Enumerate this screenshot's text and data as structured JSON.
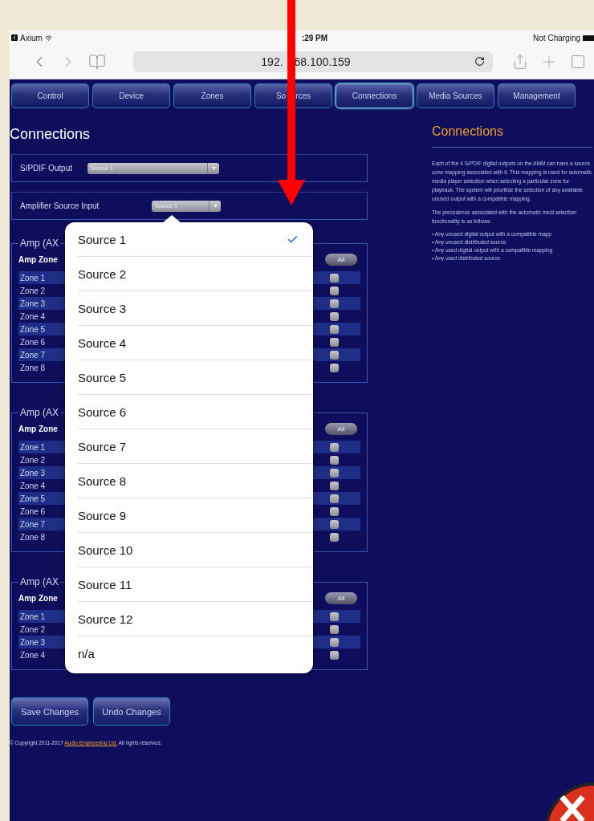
{
  "status_bar": {
    "back_app": "Axium",
    "time": ":29 PM",
    "battery": "Not Charging"
  },
  "browser": {
    "url_parts": [
      "192.",
      "68.100.159"
    ]
  },
  "tabs": [
    {
      "label": "Control",
      "selected": false
    },
    {
      "label": "Device",
      "selected": false
    },
    {
      "label": "Zones",
      "selected": false
    },
    {
      "label": [
        "So",
        "rces"
      ],
      "selected": false
    },
    {
      "label": "Connections",
      "selected": true
    },
    {
      "label": "Media Sources",
      "selected": false
    },
    {
      "label": "Management",
      "selected": false
    }
  ],
  "page": {
    "title": "Connections"
  },
  "selects": [
    {
      "label": "S/PDIF Output",
      "value": "Source 1"
    },
    {
      "label": "Amplifier Source Input",
      "value": "Source 1"
    }
  ],
  "amps": [
    {
      "title": "Amp (AX",
      "header": "Amp Zone",
      "all_button": "All",
      "zones": [
        {
          "name": "Zone 1",
          "checked": false
        },
        {
          "name": "Zone 2",
          "checked": false
        },
        {
          "name": "Zone 3",
          "checked": false
        },
        {
          "name": "Zone 4",
          "checked": false
        },
        {
          "name": "Zone 5",
          "checked": false
        },
        {
          "name": "Zone 6",
          "checked": false
        },
        {
          "name": "Zone 7",
          "checked": false
        },
        {
          "name": "Zone 8",
          "checked": false
        }
      ]
    },
    {
      "title": "Amp (AX",
      "header": "Amp Zone",
      "all_button": "All",
      "zones": [
        {
          "name": "Zone 1",
          "checked": false
        },
        {
          "name": "Zone 2",
          "checked": false
        },
        {
          "name": "Zone 3",
          "checked": false
        },
        {
          "name": "Zone 4",
          "checked": false
        },
        {
          "name": "Zone 5",
          "checked": false
        },
        {
          "name": "Zone 6",
          "checked": false
        },
        {
          "name": "Zone 7",
          "checked": false
        },
        {
          "name": "Zone 8",
          "checked": false
        }
      ]
    },
    {
      "title": "Amp (AX",
      "header": "Amp Zone",
      "all_button": "All",
      "zones": [
        {
          "name": "Zone 1",
          "checked": false
        },
        {
          "name": "Zone 2",
          "checked": false
        },
        {
          "name": "Zone 3",
          "checked": false
        },
        {
          "name": "Zone 4",
          "checked": false
        }
      ]
    }
  ],
  "popover": {
    "options": [
      {
        "label": "Source 1",
        "selected": true
      },
      {
        "label": "Source 2",
        "selected": false
      },
      {
        "label": "Source 3",
        "selected": false
      },
      {
        "label": "Source 4",
        "selected": false
      },
      {
        "label": "Source 5",
        "selected": false
      },
      {
        "label": "Source 6",
        "selected": false
      },
      {
        "label": "Source 7",
        "selected": false
      },
      {
        "label": "Source 8",
        "selected": false
      },
      {
        "label": "Source 9",
        "selected": false
      },
      {
        "label": "Source 10",
        "selected": false
      },
      {
        "label": "Source 11",
        "selected": false
      },
      {
        "label": "Source 12",
        "selected": false
      },
      {
        "label": "n/a",
        "selected": false
      }
    ]
  },
  "buttons": [
    "Save Changes",
    "Undo Changes"
  ],
  "footer": {
    "before": "© Copyright 2011-2017",
    "link": "Audio Engineering Ltd.",
    "after": "All rights reserved."
  },
  "help": {
    "title": "Connections",
    "paragraph": "Each of the 4 S/PDIF digital outputs on the AMM can have a source zone mapping associated with it. This mapping is used for automatic media player selection when selecting a particular zone for playback. The system will prioritise the selection of any available unused output with a compatible mapping.",
    "intro": "The precedence associated with the automatic medi selection functionality is as follows:",
    "bullets": [
      "• Any unused digital output with a compatible mapp",
      "• Any unused distributed source",
      "• Any used digital output with a compatible mapping",
      "• Any used distributed source"
    ]
  }
}
